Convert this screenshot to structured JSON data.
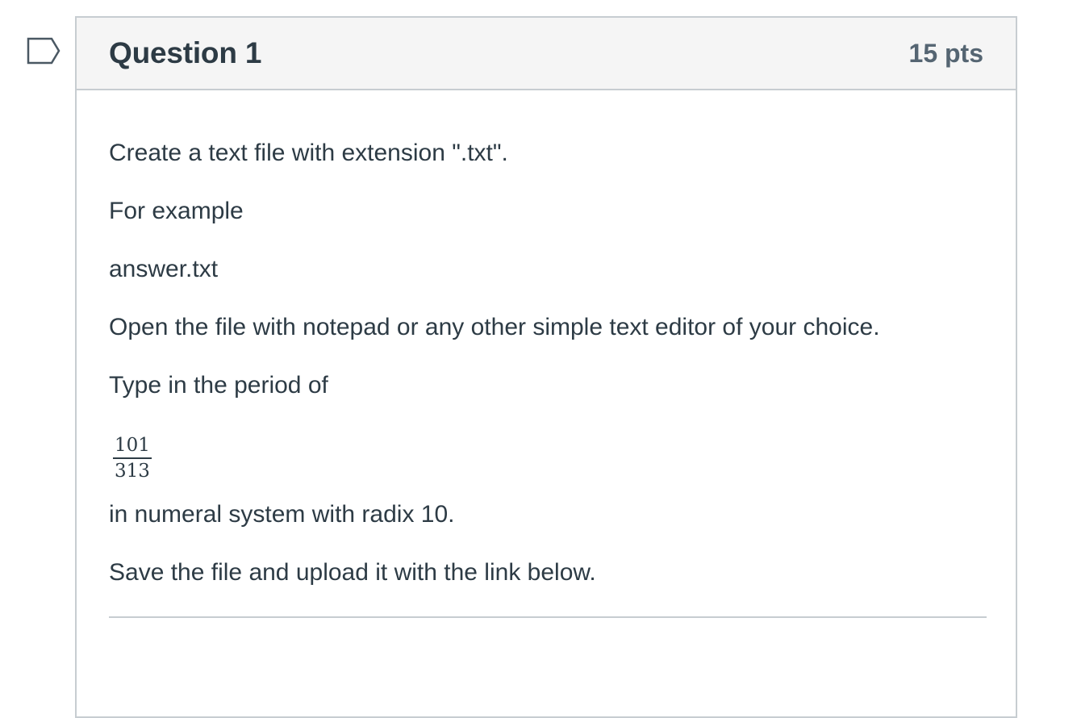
{
  "question": {
    "title": "Question 1",
    "points": "15 pts",
    "flag_icon": "flag-outline-icon",
    "body": {
      "p1": "Create a text file with extension \".txt\".",
      "p2": "For example",
      "p3": "answer.txt",
      "p4": "Open the file with notepad or any other simple text editor of your choice.",
      "p5": "Type in the period of",
      "fraction": {
        "numerator": "101",
        "denominator": "313"
      },
      "p6": "in numeral system with radix 10.",
      "p7": "Save the file and upload it with the link below."
    }
  },
  "colors": {
    "text": "#2d3b45",
    "points": "#556572",
    "border": "#c7cdd1",
    "header_bg": "#f5f5f5"
  }
}
